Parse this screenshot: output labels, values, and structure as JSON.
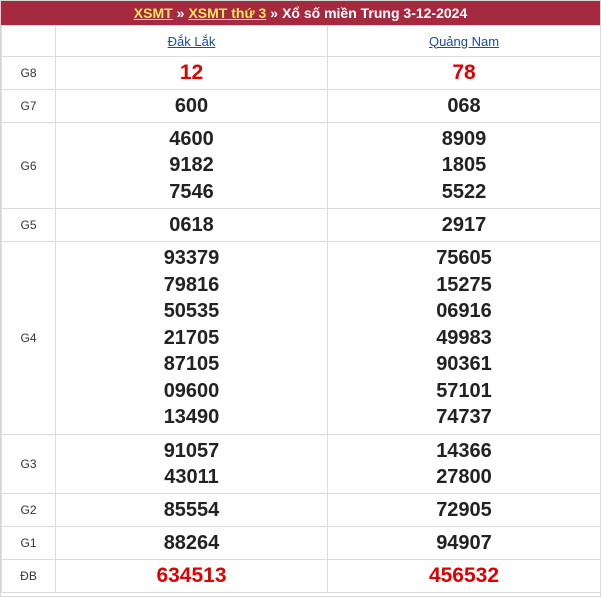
{
  "header": {
    "link1": "XSMT",
    "sep1": "»",
    "link2": "XSMT thứ 3",
    "sep2": "»",
    "title": "Xổ số miền Trung 3-12-2024"
  },
  "provinces": [
    "Đắk Lắk",
    "Quảng Nam"
  ],
  "rows": [
    {
      "prize": "G8",
      "a": [
        "12"
      ],
      "b": [
        "78"
      ]
    },
    {
      "prize": "G7",
      "a": [
        "600"
      ],
      "b": [
        "068"
      ]
    },
    {
      "prize": "G6",
      "a": [
        "4600",
        "9182",
        "7546"
      ],
      "b": [
        "8909",
        "1805",
        "5522"
      ]
    },
    {
      "prize": "G5",
      "a": [
        "0618"
      ],
      "b": [
        "2917"
      ]
    },
    {
      "prize": "G4",
      "a": [
        "93379",
        "79816",
        "50535",
        "21705",
        "87105",
        "09600",
        "13490"
      ],
      "b": [
        "75605",
        "15275",
        "06916",
        "49983",
        "90361",
        "57101",
        "74737"
      ]
    },
    {
      "prize": "G3",
      "a": [
        "91057",
        "43011"
      ],
      "b": [
        "14366",
        "27800"
      ]
    },
    {
      "prize": "G2",
      "a": [
        "85554"
      ],
      "b": [
        "72905"
      ]
    },
    {
      "prize": "G1",
      "a": [
        "88264"
      ],
      "b": [
        "94907"
      ]
    },
    {
      "prize": "ĐB",
      "a": [
        "634513"
      ],
      "b": [
        "456532"
      ]
    }
  ],
  "colors": {
    "header_bg": "#a52a3f",
    "header_link": "#f5e65b",
    "special": "#e00000",
    "province_link": "#1a4ba8"
  }
}
